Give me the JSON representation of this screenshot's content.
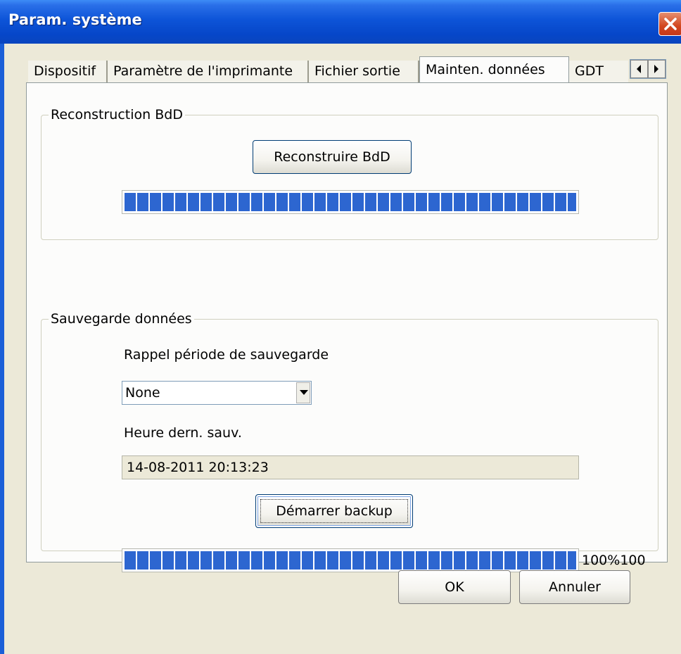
{
  "window": {
    "title": "Param. système"
  },
  "tabs": [
    {
      "label": "Dispositif",
      "active": false
    },
    {
      "label": "Paramètre de l'imprimante",
      "active": false
    },
    {
      "label": "Fichier sortie",
      "active": false
    },
    {
      "label": "Mainten. données",
      "active": true
    },
    {
      "label": "GDT",
      "active": false
    }
  ],
  "rebuild_group": {
    "title": "Reconstruction BdD",
    "button_label": "Reconstruire BdD",
    "progress_fraction": 1.0
  },
  "backup_group": {
    "title": "Sauvegarde données",
    "reminder_label": "Rappel période de sauvegarde",
    "reminder_value": "None",
    "last_backup_label": "Heure dern. sauv.",
    "last_backup_value": "14-08-2011 20:13:23",
    "start_button_label": "Démarrer backup",
    "progress_fraction": 1.0,
    "progress_text": "100%100"
  },
  "footer": {
    "ok_label": "OK",
    "cancel_label": "Annuler"
  },
  "colors": {
    "progress_fill": "#2d66d0",
    "titlebar": "#0a4fd2",
    "dialog_bg": "#ece9d8"
  },
  "icons": [
    "close-icon",
    "tab-scroll-left-icon",
    "tab-scroll-right-icon",
    "dropdown-arrow-icon"
  ]
}
